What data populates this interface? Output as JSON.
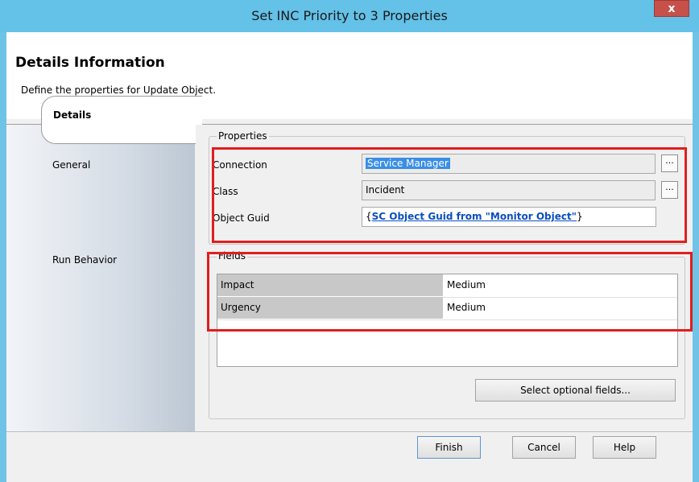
{
  "window": {
    "title": "Set INC Priority to 3  Properties",
    "close_label": "x"
  },
  "header": {
    "title": "Details Information",
    "subtitle": "Define the properties for Update Object."
  },
  "nav": {
    "items": [
      {
        "label": "General"
      },
      {
        "label": "Details",
        "selected": true
      },
      {
        "label": "Run Behavior"
      }
    ]
  },
  "properties": {
    "legend": "Properties",
    "connection_label": "Connection",
    "connection_value": "Service Manager",
    "class_label": "Class",
    "class_value": "Incident",
    "guid_label": "Object Guid",
    "guid_open": "{",
    "guid_link": "SC Object Guid from \"Monitor Object\"",
    "guid_close": "}",
    "browse_label": "..."
  },
  "fields": {
    "legend": "Fields",
    "rows": [
      {
        "name": "Impact",
        "value": "Medium"
      },
      {
        "name": "Urgency",
        "value": "Medium"
      }
    ],
    "select_optional_label": "Select optional fields..."
  },
  "footer": {
    "finish": "Finish",
    "cancel": "Cancel",
    "help": "Help"
  },
  "colors": {
    "titlebar": "#64c1e8",
    "close": "#c7504a",
    "highlight": "#e01e1e",
    "link": "#0b4fbf",
    "selection": "#3a8ee6"
  }
}
